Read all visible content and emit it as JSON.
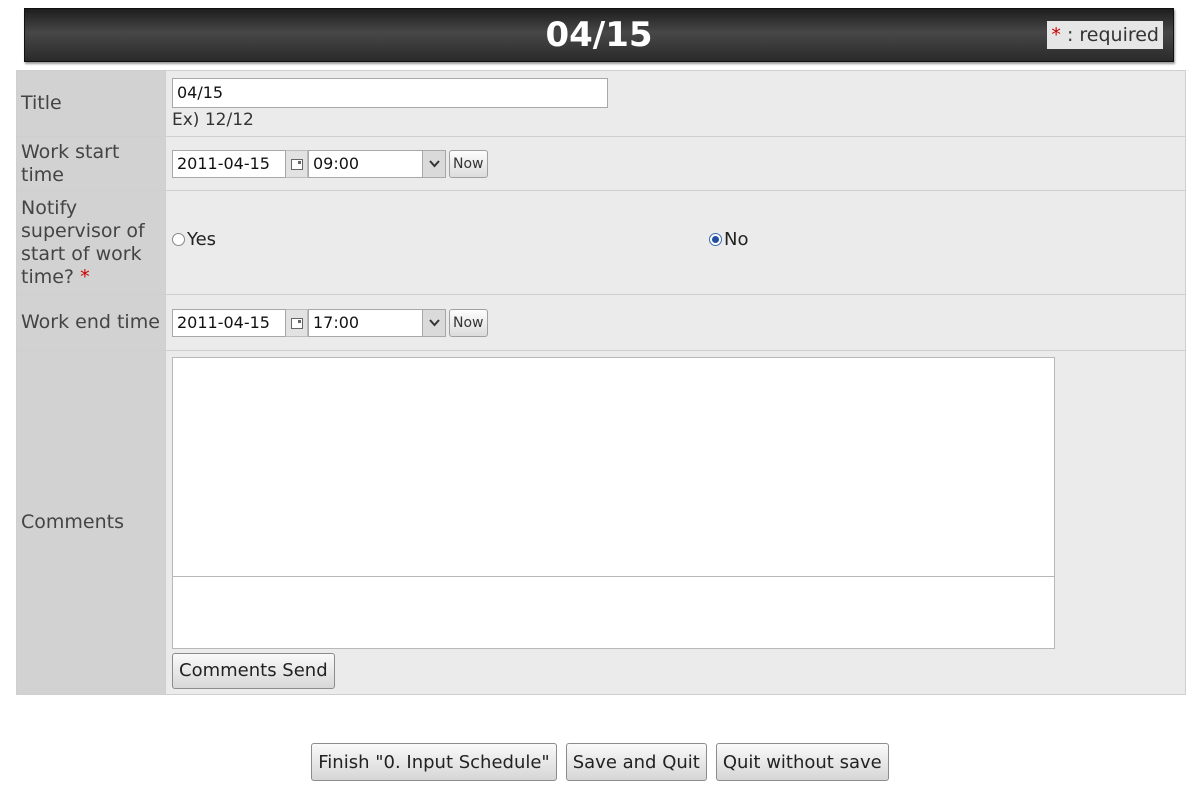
{
  "header": {
    "title": "04/15",
    "required_star": "*",
    "required_text": " : required"
  },
  "form": {
    "title_label": "Title",
    "title_value": "04/15",
    "title_hint": "Ex) 12/12",
    "start_label": "Work start time",
    "start_date": "2011-04-15",
    "start_time": "09:00",
    "now_label": "Now",
    "notify_label": "Notify supervisor of start of work time?",
    "notify_star": "*",
    "notify_options": [
      {
        "label": "Yes",
        "checked": false
      },
      {
        "label": "No",
        "checked": true
      }
    ],
    "end_label": "Work end time",
    "end_date": "2011-04-15",
    "end_time": "17:00",
    "comments_label": "Comments",
    "comments_value": "",
    "comment_input_value": "",
    "comments_send_label": "Comments Send"
  },
  "footer": {
    "buttons": [
      {
        "label": "Finish \"0. Input Schedule\""
      },
      {
        "label": "Save and Quit"
      },
      {
        "label": "Quit without save"
      }
    ]
  },
  "icons": {
    "calendar": "calendar-icon",
    "dropdown": "chevron-down-icon"
  }
}
